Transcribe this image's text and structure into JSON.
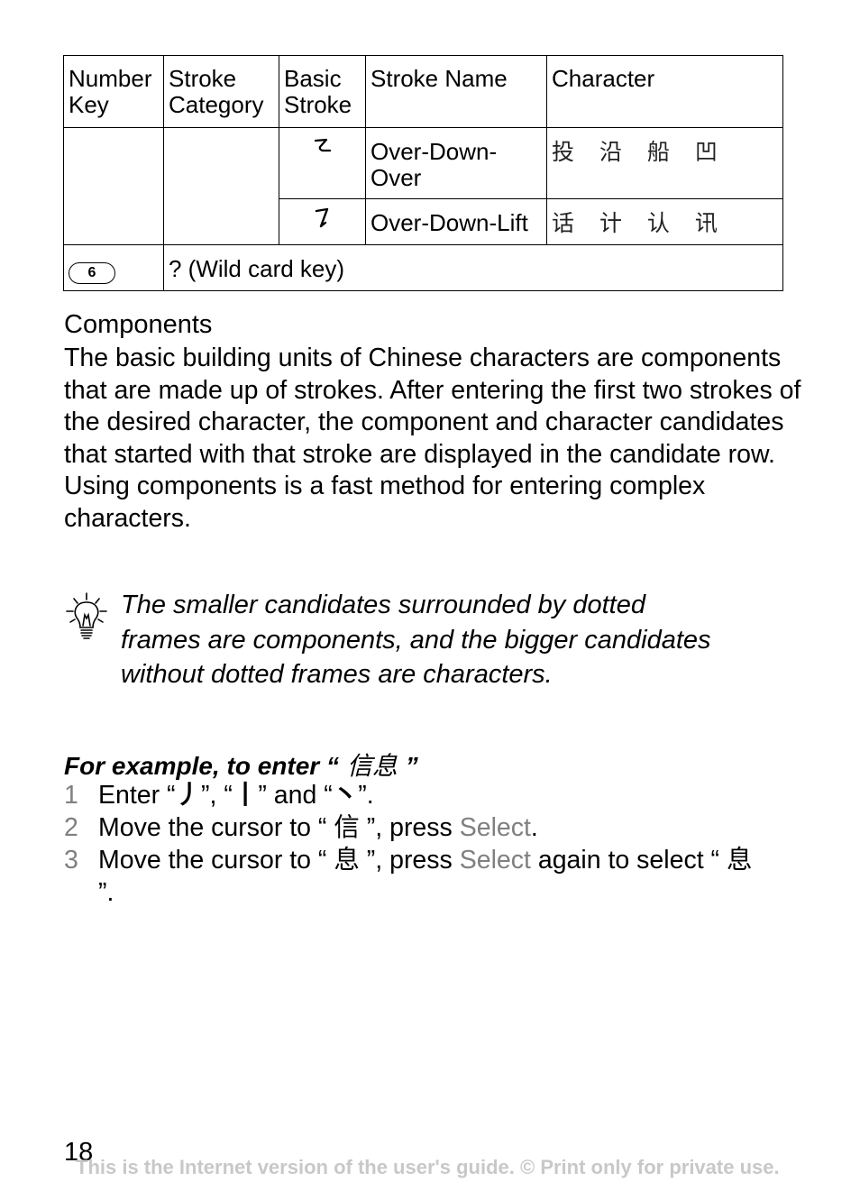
{
  "table": {
    "headers": [
      "Number Key",
      "Stroke Category",
      "Basic Stroke",
      "Stroke Name",
      "Character"
    ],
    "rows": [
      {
        "number_key": "",
        "stroke_category": "",
        "basic_stroke": "ㄹ",
        "stroke_name": "Over-Down-Over",
        "characters": "投 沿 船 凹"
      },
      {
        "basic_stroke": "㇆",
        "stroke_name": "Over-Down-Lift",
        "characters": "话 计 认 讯"
      }
    ],
    "wildcard_row": {
      "key_label": "6",
      "key_icon": "key-6-icon",
      "description": "? (Wild card key)"
    }
  },
  "section": {
    "title": "Components",
    "paragraph1": "The basic building units of Chinese characters are components that are made up of strokes. After entering the first two strokes of the desired character, the component and character candidates that started with that stroke are displayed in the candidate row.",
    "paragraph2": "Using components is a fast method for entering complex characters."
  },
  "tip": {
    "icon": "lightbulb-icon",
    "text": "The smaller candidates surrounded by dotted frames are components, and the bigger candidates without dotted frames are characters."
  },
  "example": {
    "title_prefix": "For example, to enter “",
    "title_chars": " 信息 ",
    "title_suffix": "”",
    "steps": [
      {
        "num": "1",
        "parts": {
          "a": "Enter “",
          "s1": "丿",
          "b": "”, “",
          "s2": "丨",
          "c": "” and “",
          "s3": "丶",
          "d": "”."
        }
      },
      {
        "num": "2",
        "parts": {
          "a": "Move the cursor to “ 信 ”, press ",
          "soft": "Select",
          "b": "."
        }
      },
      {
        "num": "3",
        "parts": {
          "a": "Move the cursor to “ 息 ”, press ",
          "soft": "Select",
          "b": " again to select “ 息 ”."
        }
      }
    ]
  },
  "page": {
    "number": "18",
    "footer": "This is the Internet version of the user's guide. © Print only for private use."
  }
}
